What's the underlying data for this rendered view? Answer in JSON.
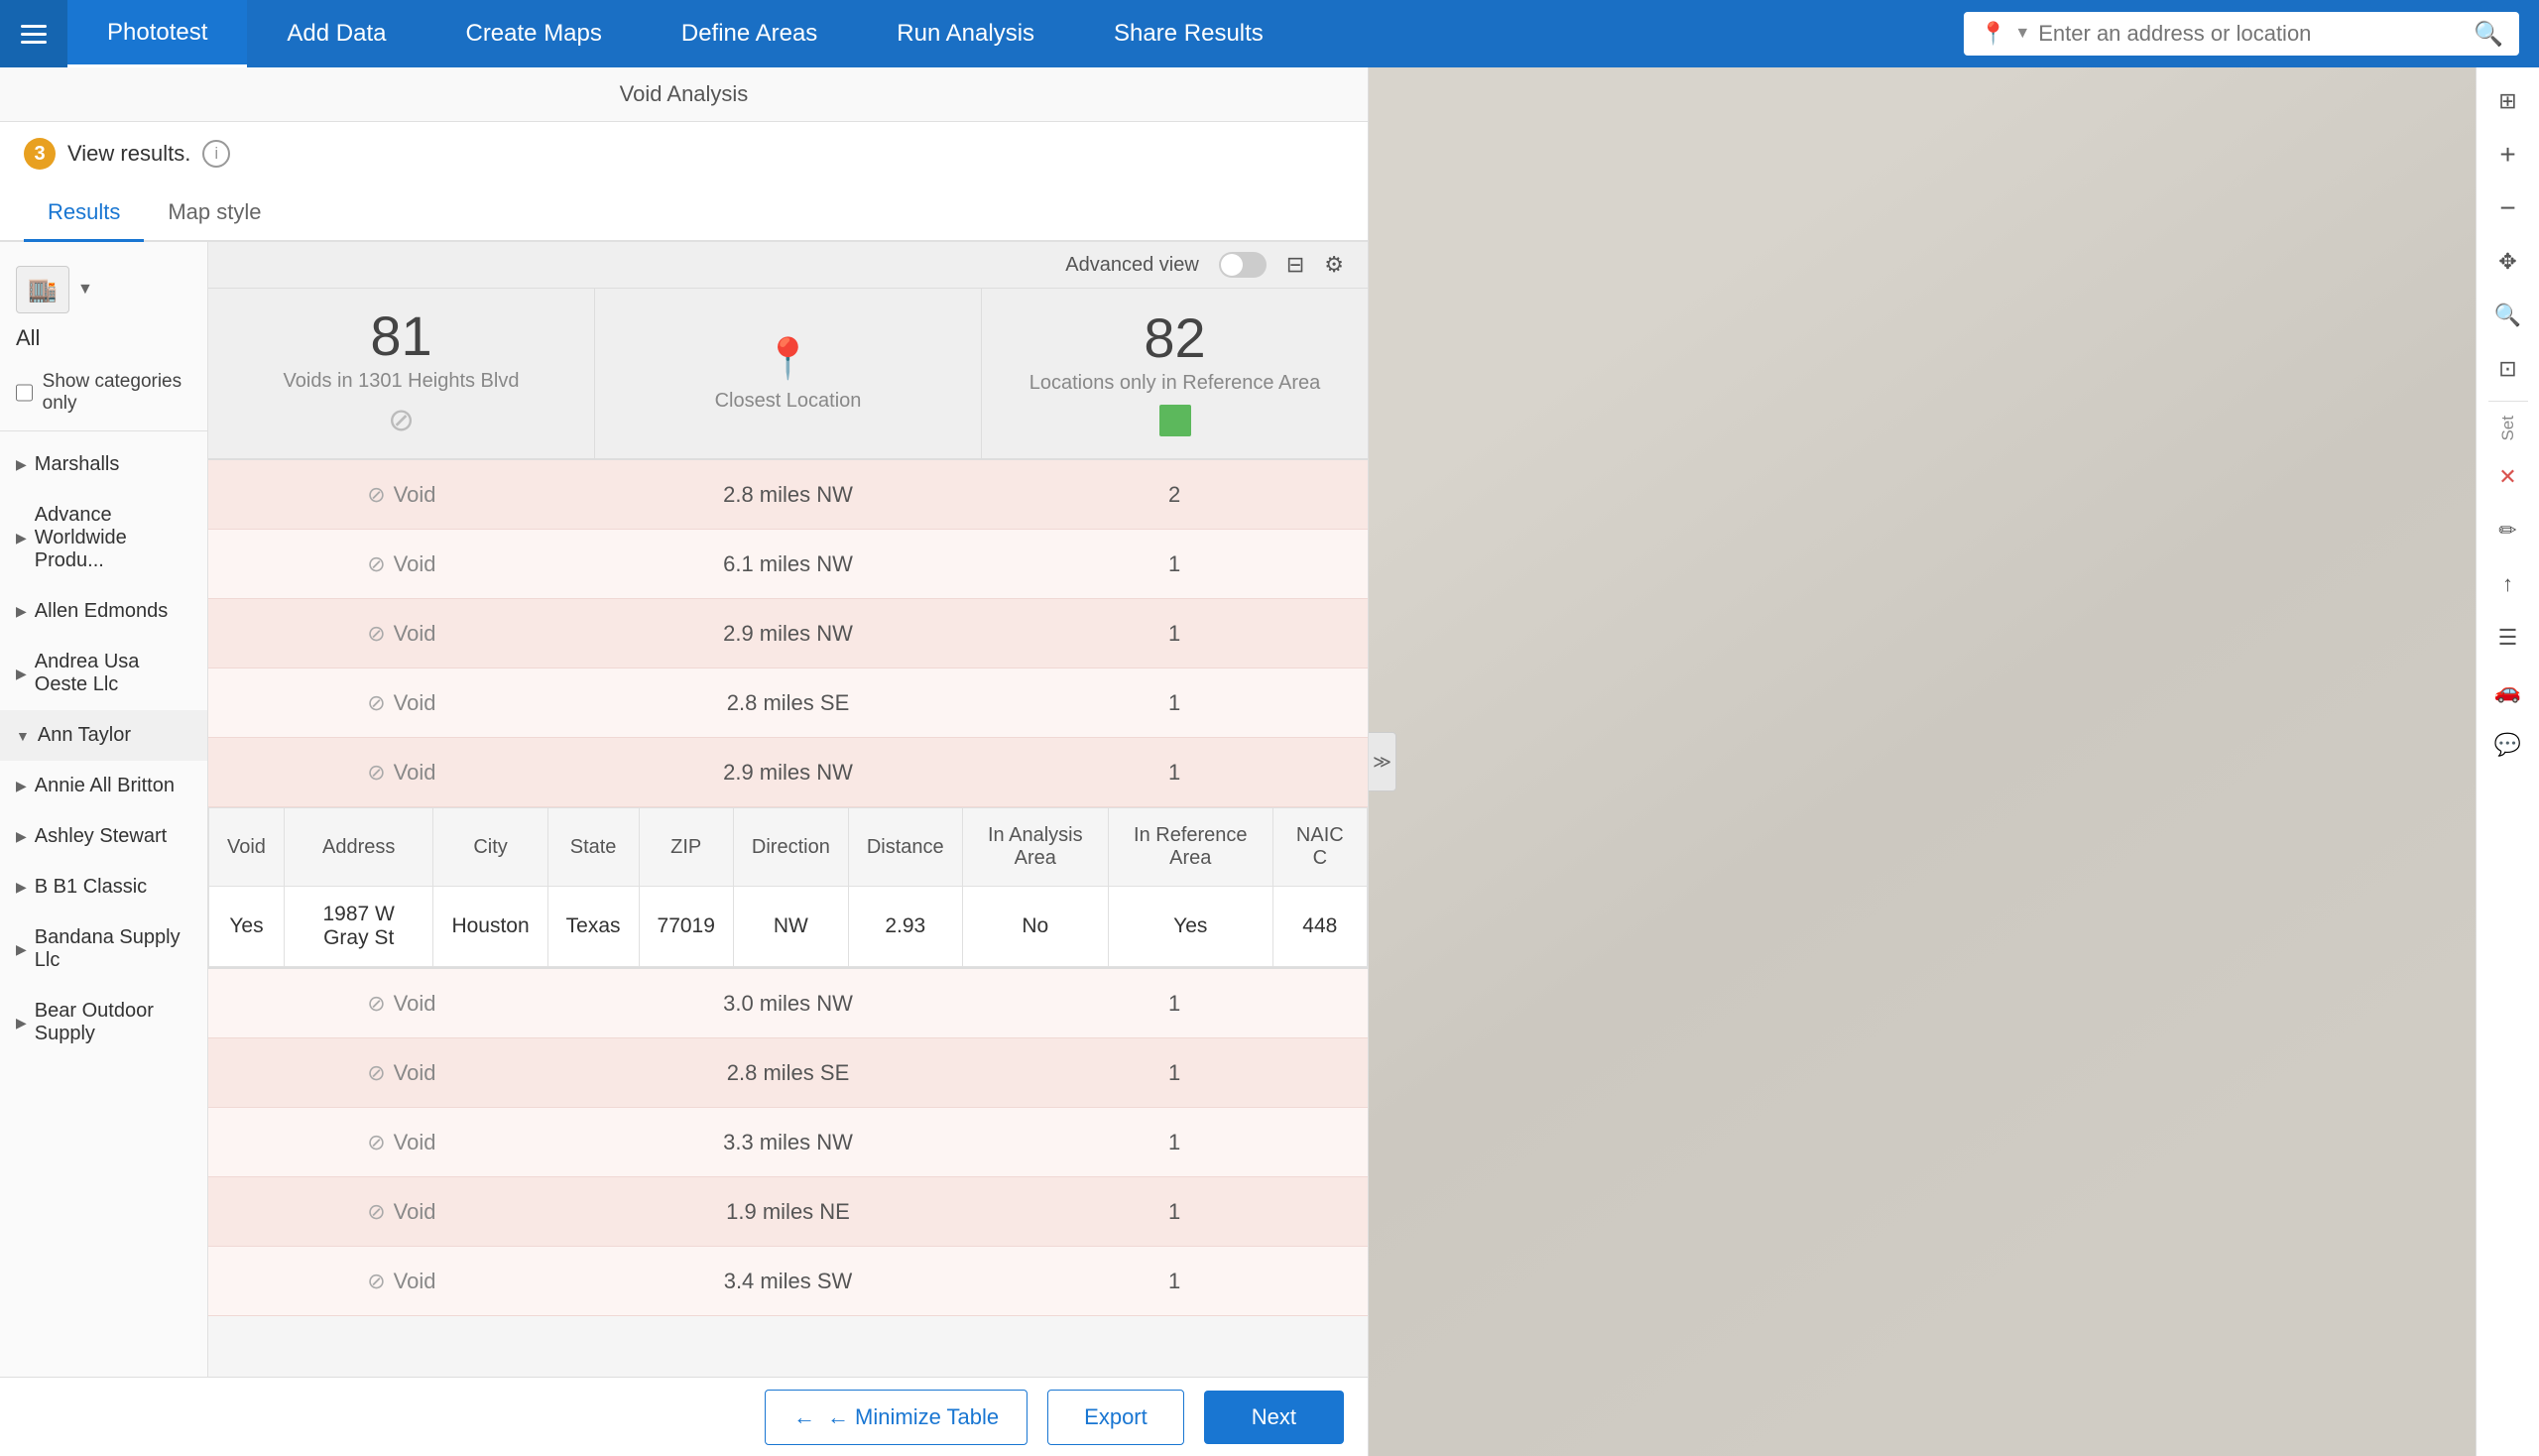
{
  "nav": {
    "hamburger_label": "Menu",
    "tabs": [
      {
        "id": "phototest",
        "label": "Phototest",
        "active": true
      },
      {
        "id": "add-data",
        "label": "Add Data",
        "active": false
      },
      {
        "id": "create-maps",
        "label": "Create Maps",
        "active": false
      },
      {
        "id": "define-areas",
        "label": "Define Areas",
        "active": false
      },
      {
        "id": "run-analysis",
        "label": "Run Analysis",
        "active": false
      },
      {
        "id": "share-results",
        "label": "Share Results",
        "active": false
      }
    ],
    "search_placeholder": "Enter an address or location"
  },
  "page_title": "Void Analysis",
  "view_results": {
    "step": "3",
    "label": "View results.",
    "info_tooltip": "Information"
  },
  "tabs": [
    {
      "id": "results",
      "label": "Results",
      "active": true
    },
    {
      "id": "map-style",
      "label": "Map style",
      "active": false
    }
  ],
  "sidebar": {
    "category_icon": "🏬",
    "all_label": "All",
    "show_categories_label": "Show categories only",
    "items": [
      {
        "id": "marshalls",
        "label": "Marshalls"
      },
      {
        "id": "advance-worldwide",
        "label": "Advance Worldwide Produ..."
      },
      {
        "id": "allen-edmonds",
        "label": "Allen Edmonds"
      },
      {
        "id": "andrea-usa",
        "label": "Andrea Usa Oeste Llc"
      },
      {
        "id": "ann-taylor",
        "label": "Ann Taylor",
        "expanded": true
      },
      {
        "id": "annie-all-britton",
        "label": "Annie All Britton"
      },
      {
        "id": "ashley-stewart",
        "label": "Ashley Stewart"
      },
      {
        "id": "b-b1-classic",
        "label": "B B1 Classic"
      },
      {
        "id": "bandana-supply",
        "label": "Bandana Supply Llc"
      },
      {
        "id": "bear-outdoor",
        "label": "Bear Outdoor Supply"
      }
    ]
  },
  "summary": {
    "advanced_view_label": "Advanced view",
    "voids_count": "81",
    "voids_label": "Voids in 1301 Heights Blvd",
    "closest_location_label": "Closest Location",
    "ref_area_count": "82",
    "ref_area_label": "Locations only in Reference Area"
  },
  "data_rows": [
    {
      "id": "marshalls",
      "label": "Marshalls",
      "void": "Void",
      "distance": "2.8 miles NW",
      "count": "2"
    },
    {
      "id": "advance-worldwide",
      "label": "Advance Worldwide Produ...",
      "void": "Void",
      "distance": "6.1 miles NW",
      "count": "1"
    },
    {
      "id": "allen-edmonds",
      "label": "Allen Edmonds",
      "void": "Void",
      "distance": "2.9 miles NW",
      "count": "1"
    },
    {
      "id": "andrea-usa",
      "label": "Andrea Usa Oeste Llc",
      "void": "Void",
      "distance": "2.8 miles SE",
      "count": "1"
    },
    {
      "id": "ann-taylor",
      "label": "Ann Taylor",
      "void": "Void",
      "distance": "2.9 miles NW",
      "count": "1"
    },
    {
      "id": "annie-all-britton",
      "label": "Annie All Britton",
      "void": "Void",
      "distance": "3.0 miles NW",
      "count": "1"
    },
    {
      "id": "ashley-stewart",
      "label": "Ashley Stewart",
      "void": "Void",
      "distance": "2.8 miles SE",
      "count": "1"
    },
    {
      "id": "b-b1-classic",
      "label": "B B1 Classic",
      "void": "Void",
      "distance": "3.3 miles NW",
      "count": "1"
    },
    {
      "id": "bandana-supply",
      "label": "Bandana Supply Llc",
      "void": "Void",
      "distance": "1.9 miles NE",
      "count": "1"
    },
    {
      "id": "bear-outdoor",
      "label": "Bear Outdoor Supply",
      "void": "Void",
      "distance": "3.4 miles SW",
      "count": "1"
    }
  ],
  "sub_table": {
    "headers": [
      "Void",
      "Address",
      "City",
      "State",
      "ZIP",
      "Direction",
      "Distance",
      "In Analysis Area",
      "In Reference Area",
      "NAIC C"
    ],
    "row": {
      "void": "Yes",
      "address": "1987 W Gray St",
      "city": "Houston",
      "state": "Texas",
      "zip": "77019",
      "direction": "NW",
      "distance": "2.93",
      "in_analysis": "No",
      "in_reference": "Yes",
      "naic": "448"
    }
  },
  "bottom_bar": {
    "minimize_label": "← Minimize Table",
    "export_label": "Export",
    "next_label": "Next"
  },
  "right_toolbar": {
    "buttons": [
      {
        "id": "collapse",
        "icon": "≫",
        "label": "collapse"
      },
      {
        "id": "zoom-extent",
        "icon": "⊞",
        "label": "zoom-extent"
      },
      {
        "id": "zoom-in",
        "icon": "+",
        "label": "zoom-in"
      },
      {
        "id": "zoom-out",
        "icon": "−",
        "label": "zoom-out"
      },
      {
        "id": "pan",
        "icon": "✥",
        "label": "pan"
      },
      {
        "id": "zoom-tool",
        "icon": "⊕",
        "label": "zoom-tool"
      },
      {
        "id": "layers",
        "icon": "⊡",
        "label": "layers"
      },
      {
        "id": "set-label",
        "label": "Set"
      },
      {
        "id": "close",
        "icon": "✕",
        "label": "close"
      },
      {
        "id": "edit",
        "icon": "✏",
        "label": "edit"
      },
      {
        "id": "share",
        "icon": "↑",
        "label": "share"
      },
      {
        "id": "table",
        "icon": "☰",
        "label": "table"
      },
      {
        "id": "car",
        "icon": "🚗",
        "label": "car"
      },
      {
        "id": "comment",
        "icon": "💬",
        "label": "comment"
      }
    ]
  }
}
